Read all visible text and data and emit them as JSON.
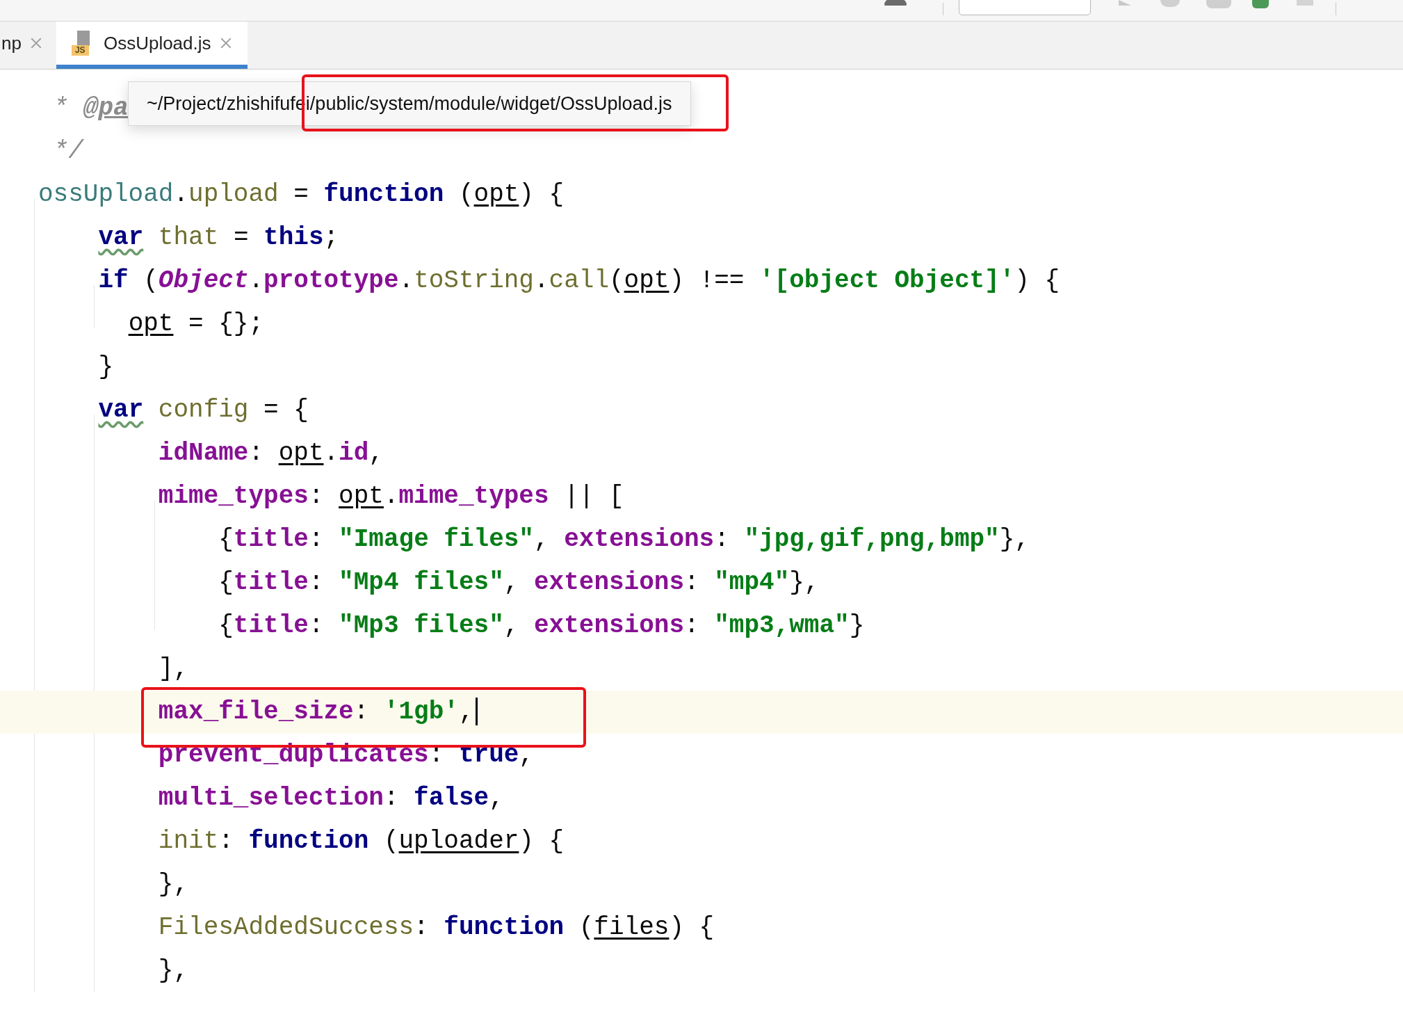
{
  "tabs": [
    {
      "label": "np",
      "selected": false
    },
    {
      "label": "OssUpload.js",
      "selected": true,
      "icon_label": "JS"
    }
  ],
  "tooltip": {
    "text": "~/Project/zhishifufei/public/system/module/widget/OssUpload.js"
  },
  "code_lines": [
    {
      "tokens": [
        {
          "kind": "comment",
          "text": " *"
        },
        {
          "kind": "comment-tag",
          "text": " @pa"
        }
      ]
    },
    {
      "tokens": [
        {
          "kind": "comment",
          "text": " */"
        }
      ]
    },
    {
      "tokens": [
        {
          "kind": "global",
          "text": "ossUpload"
        },
        {
          "kind": "plain",
          "text": "."
        },
        {
          "kind": "member",
          "text": "upload"
        },
        {
          "kind": "plain",
          "text": " ="
        },
        {
          "kind": "keyword",
          "text": " function"
        },
        {
          "kind": "plain",
          "text": " ("
        },
        {
          "kind": "param",
          "text": "opt"
        },
        {
          "kind": "plain",
          "text": ") {"
        }
      ]
    },
    {
      "tokens": [
        {
          "kind": "keyword-warn",
          "text": "    var"
        },
        {
          "kind": "member",
          "text": " that"
        },
        {
          "kind": "plain",
          "text": " ="
        },
        {
          "kind": "keyword",
          "text": " this"
        },
        {
          "kind": "plain",
          "text": ";"
        }
      ]
    },
    {
      "tokens": [
        {
          "kind": "keyword",
          "text": "    if"
        },
        {
          "kind": "plain",
          "text": " ("
        },
        {
          "kind": "class",
          "text": "Object"
        },
        {
          "kind": "plain",
          "text": "."
        },
        {
          "kind": "prop",
          "text": "prototype"
        },
        {
          "kind": "plain",
          "text": "."
        },
        {
          "kind": "member",
          "text": "toString"
        },
        {
          "kind": "plain",
          "text": "."
        },
        {
          "kind": "member",
          "text": "call"
        },
        {
          "kind": "plain",
          "text": "("
        },
        {
          "kind": "param",
          "text": "opt"
        },
        {
          "kind": "plain",
          "text": ") !=="
        },
        {
          "kind": "string",
          "text": " '[object Object]'"
        },
        {
          "kind": "plain",
          "text": ") {"
        }
      ]
    },
    {
      "tokens": [
        {
          "kind": "param",
          "text": "      opt"
        },
        {
          "kind": "plain",
          "text": " = {};"
        }
      ]
    },
    {
      "tokens": [
        {
          "kind": "plain",
          "text": "    }"
        }
      ]
    },
    {
      "tokens": [
        {
          "kind": "keyword-warn",
          "text": "    var"
        },
        {
          "kind": "member",
          "text": " config"
        },
        {
          "kind": "plain",
          "text": " = {"
        }
      ]
    },
    {
      "tokens": [
        {
          "kind": "prop",
          "text": "        idName"
        },
        {
          "kind": "plain",
          "text": ":"
        },
        {
          "kind": "param",
          "text": " opt"
        },
        {
          "kind": "plain",
          "text": "."
        },
        {
          "kind": "prop",
          "text": "id"
        },
        {
          "kind": "plain",
          "text": ","
        }
      ]
    },
    {
      "tokens": [
        {
          "kind": "prop",
          "text": "        mime_types"
        },
        {
          "kind": "plain",
          "text": ":"
        },
        {
          "kind": "param",
          "text": " opt"
        },
        {
          "kind": "plain",
          "text": "."
        },
        {
          "kind": "prop",
          "text": "mime_types"
        },
        {
          "kind": "plain",
          "text": " || ["
        }
      ]
    },
    {
      "tokens": [
        {
          "kind": "plain",
          "text": "            {"
        },
        {
          "kind": "prop",
          "text": "title"
        },
        {
          "kind": "plain",
          "text": ":"
        },
        {
          "kind": "string",
          "text": " \"Image files\""
        },
        {
          "kind": "plain",
          "text": ","
        },
        {
          "kind": "prop",
          "text": " extensions"
        },
        {
          "kind": "plain",
          "text": ":"
        },
        {
          "kind": "string",
          "text": " \"jpg,gif,png,bmp\""
        },
        {
          "kind": "plain",
          "text": "},"
        }
      ]
    },
    {
      "tokens": [
        {
          "kind": "plain",
          "text": "            {"
        },
        {
          "kind": "prop",
          "text": "title"
        },
        {
          "kind": "plain",
          "text": ":"
        },
        {
          "kind": "string",
          "text": " \"Mp4 files\""
        },
        {
          "kind": "plain",
          "text": ","
        },
        {
          "kind": "prop",
          "text": " extensions"
        },
        {
          "kind": "plain",
          "text": ":"
        },
        {
          "kind": "string",
          "text": " \"mp4\""
        },
        {
          "kind": "plain",
          "text": "},"
        }
      ]
    },
    {
      "tokens": [
        {
          "kind": "plain",
          "text": "            {"
        },
        {
          "kind": "prop",
          "text": "title"
        },
        {
          "kind": "plain",
          "text": ":"
        },
        {
          "kind": "string",
          "text": " \"Mp3 files\""
        },
        {
          "kind": "plain",
          "text": ","
        },
        {
          "kind": "prop",
          "text": " extensions"
        },
        {
          "kind": "plain",
          "text": ":"
        },
        {
          "kind": "string",
          "text": " \"mp3,wma\""
        },
        {
          "kind": "plain",
          "text": "}"
        }
      ]
    },
    {
      "tokens": [
        {
          "kind": "plain",
          "text": "        ],"
        }
      ]
    },
    {
      "current": true,
      "caret": true,
      "tokens": [
        {
          "kind": "prop",
          "text": "        max_file_size"
        },
        {
          "kind": "plain",
          "text": ":"
        },
        {
          "kind": "string",
          "text": " '1gb'"
        },
        {
          "kind": "plain",
          "text": ","
        }
      ]
    },
    {
      "tokens": [
        {
          "kind": "prop",
          "text": "        prevent_duplicates"
        },
        {
          "kind": "plain",
          "text": ":"
        },
        {
          "kind": "keyword",
          "text": " true"
        },
        {
          "kind": "plain",
          "text": ","
        }
      ]
    },
    {
      "tokens": [
        {
          "kind": "prop",
          "text": "        multi_selection"
        },
        {
          "kind": "plain",
          "text": ":"
        },
        {
          "kind": "keyword",
          "text": " false"
        },
        {
          "kind": "plain",
          "text": ","
        }
      ]
    },
    {
      "tokens": [
        {
          "kind": "member",
          "text": "        init"
        },
        {
          "kind": "plain",
          "text": ":"
        },
        {
          "kind": "keyword",
          "text": " function"
        },
        {
          "kind": "plain",
          "text": " ("
        },
        {
          "kind": "param",
          "text": "uploader"
        },
        {
          "kind": "plain",
          "text": ") {"
        }
      ]
    },
    {
      "tokens": [
        {
          "kind": "plain",
          "text": "        },"
        }
      ]
    },
    {
      "tokens": [
        {
          "kind": "member",
          "text": "        FilesAddedSuccess"
        },
        {
          "kind": "plain",
          "text": ":"
        },
        {
          "kind": "keyword",
          "text": " function"
        },
        {
          "kind": "plain",
          "text": " ("
        },
        {
          "kind": "param",
          "text": "files"
        },
        {
          "kind": "plain",
          "text": ") {"
        }
      ]
    },
    {
      "tokens": [
        {
          "kind": "plain",
          "text": "        },"
        }
      ]
    }
  ]
}
